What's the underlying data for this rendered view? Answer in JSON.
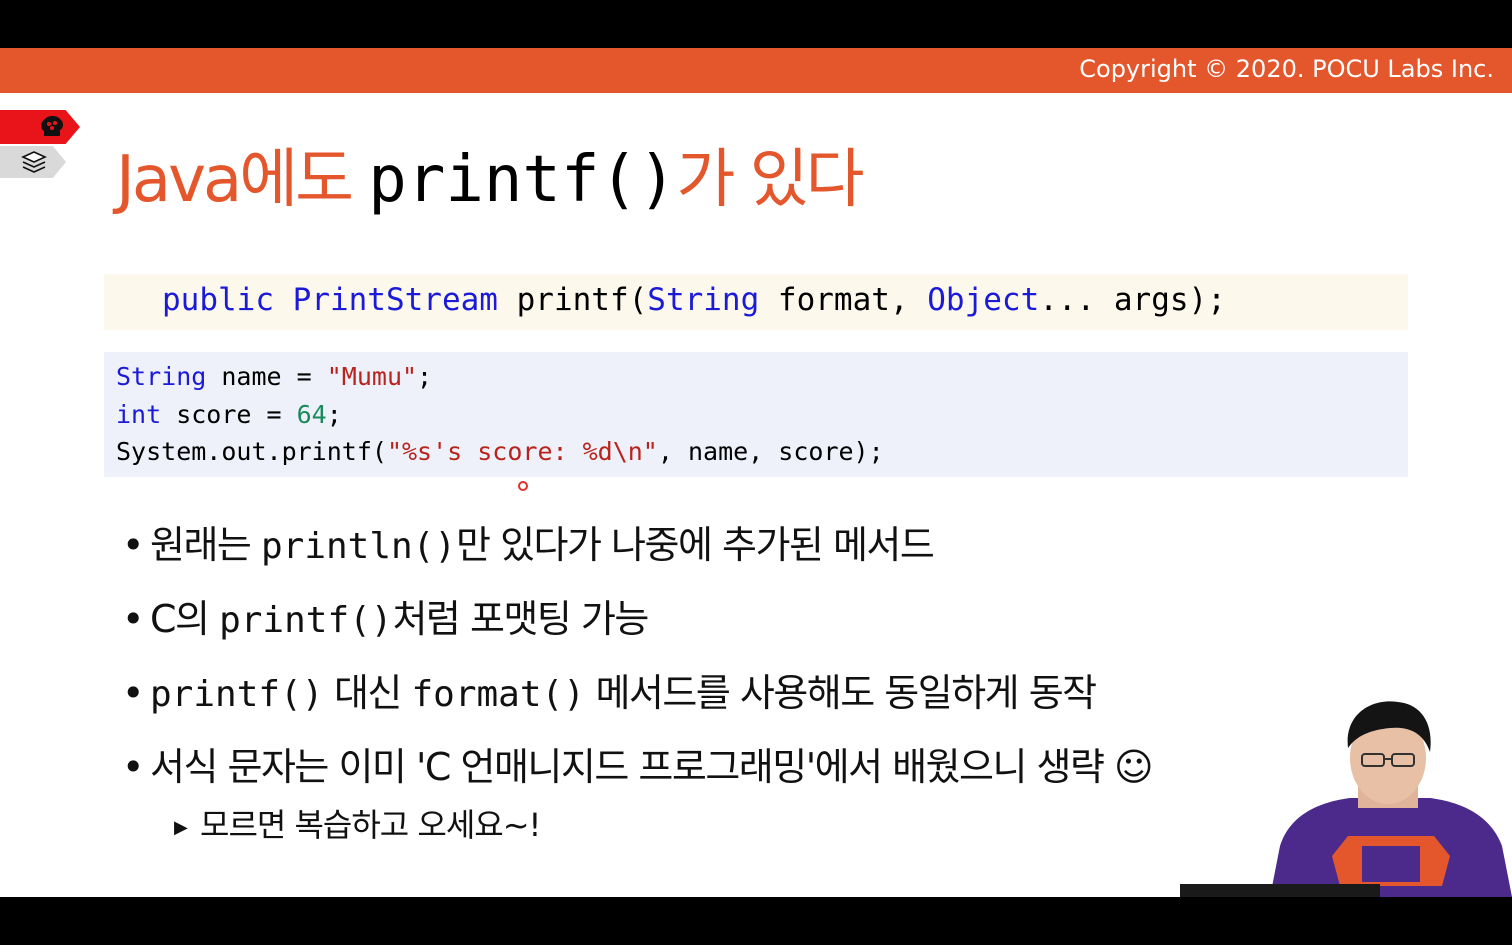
{
  "header": {
    "copyright": "Copyright © 2020. POCU Labs Inc."
  },
  "title": {
    "prefix": "Java에도",
    "code": "printf()",
    "suffix": "가 있다"
  },
  "signature": {
    "kw_public": "public",
    "type_printstream": "PrintStream",
    "method_open": " printf(",
    "type_string": "String",
    "param_format": " format, ",
    "type_object": "Object",
    "rest": "... args);"
  },
  "code": {
    "line1": {
      "type": "String",
      "rest": " name = ",
      "str": "\"Mumu\"",
      "end": ";"
    },
    "line2": {
      "type": "int",
      "rest": " score = ",
      "num": "64",
      "end": ";"
    },
    "line3": {
      "start": "System.out.printf(",
      "str": "\"%s's score: %d\\n\"",
      "end": ", name, score);"
    }
  },
  "bullets": {
    "b1": {
      "pre": "원래는 ",
      "code": "println()",
      "post": "만 있다가 나중에 추가된 메서드"
    },
    "b2": {
      "pre": "C의 ",
      "code": "printf()",
      "post": "처럼 포맷팅 가능"
    },
    "b3": {
      "code1": "printf()",
      "mid": " 대신 ",
      "code2": "format()",
      "post": " 메서드를 사용해도 동일하게 동작"
    },
    "b4": {
      "text": "서식 문자는 이미 'C 언매니지드 프로그래밍'에서 배웠으니 생략 ☺"
    },
    "sub1": {
      "text": "모르면 복습하고 오세요~!"
    }
  },
  "colors": {
    "accent": "#e4562c",
    "keyword": "#1a1ad8",
    "string": "#b8231c",
    "number": "#1a8a5a"
  }
}
